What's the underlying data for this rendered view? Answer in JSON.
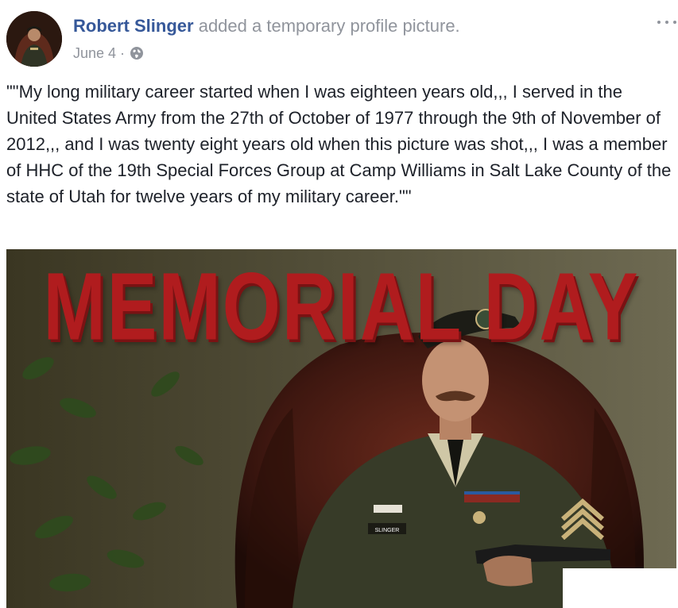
{
  "post": {
    "author_name": "Robert Slinger",
    "action_text": "added a temporary profile picture.",
    "date": "June 4",
    "separator": "·",
    "privacy_icon": "globe-icon",
    "more_icon": "more-options-icon",
    "text": "\"\"My long military career started when I was eighteen years old,,, I served in the United States Army from the 27th of October of 1977 through the 9th of November of 2012,,, and I was twenty eight years old when this picture was shot,,, I was a member of HHC of the 19th Special Forces Group at Camp Williams in Salt Lake County of the state of Utah for twelve years of my military career.\"\""
  },
  "photo": {
    "banner_text": "MEMORIAL DAY",
    "name_tag": "SLINGER",
    "banner_color": "#b01c1e"
  },
  "colors": {
    "link": "#365899",
    "meta": "#90949c",
    "text": "#1d2129"
  }
}
